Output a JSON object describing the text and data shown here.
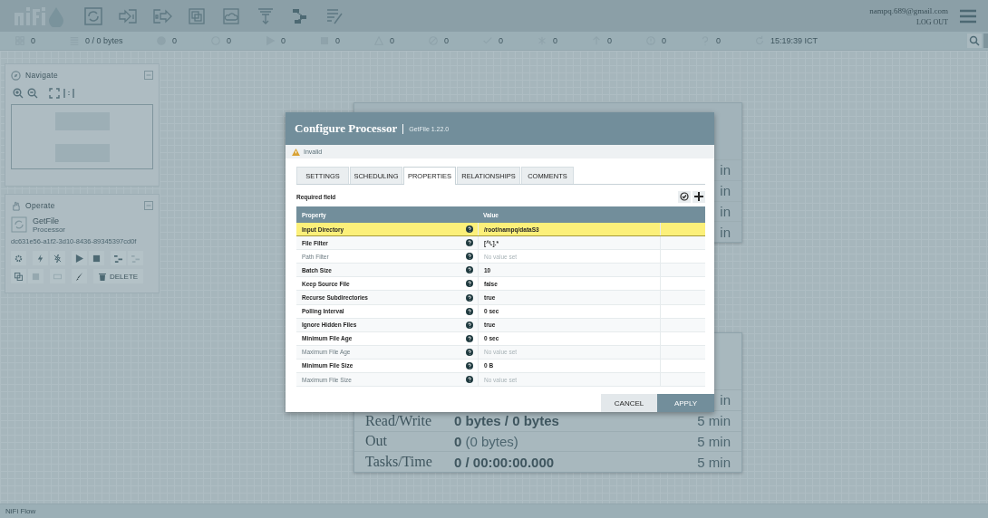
{
  "header": {
    "user": "nampq.689@gmail.com",
    "logout": "LOG OUT"
  },
  "status_bar": [
    {
      "kind": "cluster",
      "text": "0"
    },
    {
      "kind": "queue",
      "text": "0 / 0 bytes"
    },
    {
      "kind": "transmitting",
      "text": "0"
    },
    {
      "kind": "not-transmitting",
      "text": "0"
    },
    {
      "kind": "running",
      "text": "0"
    },
    {
      "kind": "stopped",
      "text": "0"
    },
    {
      "kind": "invalid",
      "text": "0"
    },
    {
      "kind": "disabled",
      "text": "0"
    },
    {
      "kind": "up-to-date",
      "text": "0"
    },
    {
      "kind": "modified",
      "text": "0"
    },
    {
      "kind": "stale",
      "text": "0"
    },
    {
      "kind": "errors",
      "text": "0"
    },
    {
      "kind": "sync-failure",
      "text": "0"
    },
    {
      "kind": "refresh",
      "text": "15:19:39 ICT"
    }
  ],
  "navigate": {
    "title": "Navigate"
  },
  "operate": {
    "title": "Operate",
    "component_name": "GetFile",
    "component_type": "Processor",
    "component_id": "dc631e56-a1f2-3d10-8436-89345397cd0f",
    "delete": "DELETE"
  },
  "canvas": {
    "upper_processor_rows": [
      "in",
      "in",
      "in",
      "in"
    ],
    "lower_processor_rows": [
      {
        "label": "",
        "value": "",
        "period": "in"
      },
      {
        "label": "Read/Write",
        "value": "**0 bytes / 0 bytes**",
        "period": "5 min"
      },
      {
        "label": "Out",
        "value": "**0** (0 bytes)",
        "period": "5 min"
      },
      {
        "label": "Tasks/Time",
        "value": "**0 / 00:00:00.000**",
        "period": "5 min"
      }
    ]
  },
  "dialog": {
    "title": "Configure Processor",
    "subtitle": "GetFile 1.22.0",
    "status": "Invalid",
    "tabs": [
      {
        "label": "SETTINGS",
        "selected": false
      },
      {
        "label": "SCHEDULING",
        "selected": false
      },
      {
        "label": "PROPERTIES",
        "selected": true
      },
      {
        "label": "RELATIONSHIPS",
        "selected": false
      },
      {
        "label": "COMMENTS",
        "selected": false
      }
    ],
    "required_note": "Required field",
    "columns": [
      "Property",
      "Value"
    ],
    "properties": [
      {
        "name": "Input Directory",
        "value": "/root/nampq/dataS3",
        "required": true,
        "has_value": true,
        "selected": true
      },
      {
        "name": "File Filter",
        "value": "[^\\.].*",
        "required": true,
        "has_value": true,
        "selected": false
      },
      {
        "name": "Path Filter",
        "value": "No value set",
        "required": false,
        "has_value": false,
        "selected": false
      },
      {
        "name": "Batch Size",
        "value": "10",
        "required": true,
        "has_value": true,
        "selected": false
      },
      {
        "name": "Keep Source File",
        "value": "false",
        "required": true,
        "has_value": true,
        "selected": false
      },
      {
        "name": "Recurse Subdirectories",
        "value": "true",
        "required": true,
        "has_value": true,
        "selected": false
      },
      {
        "name": "Polling Interval",
        "value": "0 sec",
        "required": true,
        "has_value": true,
        "selected": false
      },
      {
        "name": "Ignore Hidden Files",
        "value": "true",
        "required": true,
        "has_value": true,
        "selected": false
      },
      {
        "name": "Minimum File Age",
        "value": "0 sec",
        "required": true,
        "has_value": true,
        "selected": false
      },
      {
        "name": "Maximum File Age",
        "value": "No value set",
        "required": false,
        "has_value": false,
        "selected": false
      },
      {
        "name": "Minimum File Size",
        "value": "0 B",
        "required": true,
        "has_value": true,
        "selected": false
      },
      {
        "name": "Maximum File Size",
        "value": "No value set",
        "required": false,
        "has_value": false,
        "selected": false
      }
    ],
    "buttons": [
      "CANCEL",
      "APPLY"
    ]
  },
  "breadcrumb": "NiFi Flow"
}
